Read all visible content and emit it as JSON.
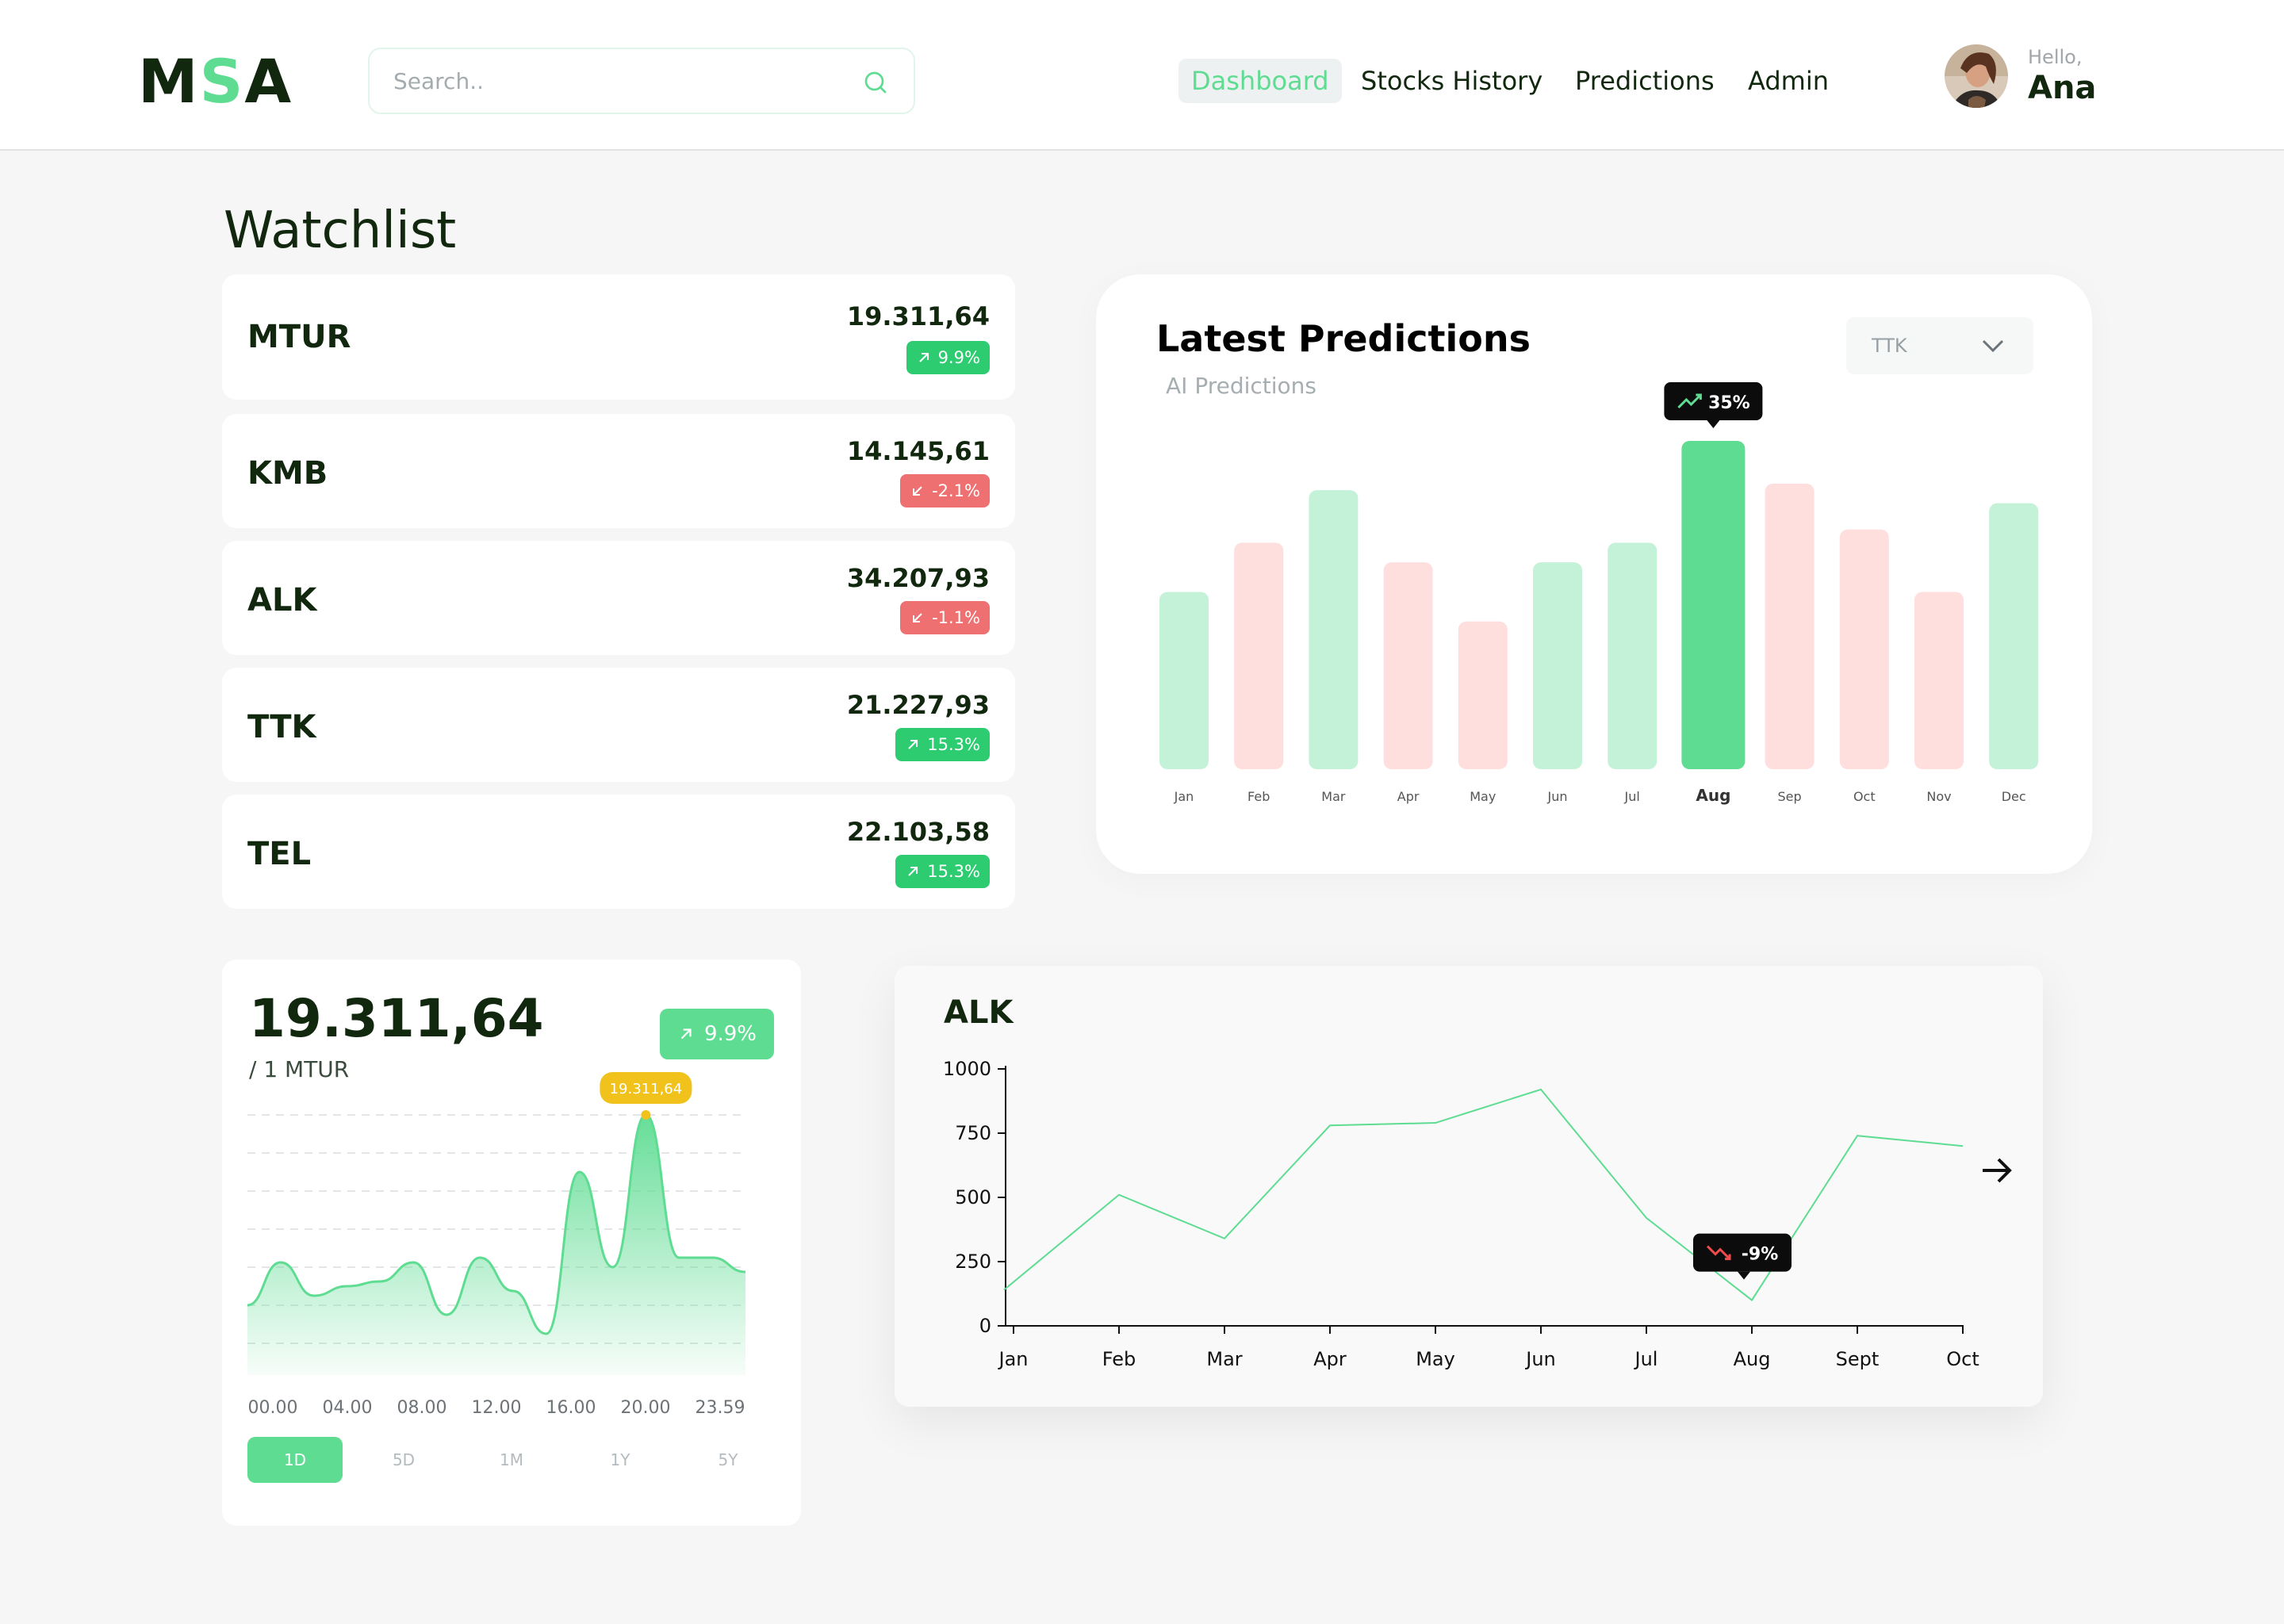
{
  "header": {
    "logo_prefix": "M",
    "logo_accent": "S",
    "logo_suffix": "A",
    "search_placeholder": "Search..",
    "nav": [
      {
        "label": "Dashboard",
        "active": true
      },
      {
        "label": "Stocks History",
        "active": false
      },
      {
        "label": "Predictions",
        "active": false
      },
      {
        "label": "Admin",
        "active": false
      }
    ],
    "user": {
      "greeting": "Hello,",
      "name": "Ana"
    }
  },
  "watchlist": {
    "title": "Watchlist",
    "items": [
      {
        "symbol": "MTUR",
        "price": "19.311,64",
        "change": "9.9%",
        "direction": "up"
      },
      {
        "symbol": "KMB",
        "price": "14.145,61",
        "change": "-2.1%",
        "direction": "down"
      },
      {
        "symbol": "ALK",
        "price": "34.207,93",
        "change": "-1.1%",
        "direction": "down"
      },
      {
        "symbol": "TTK",
        "price": "21.227,93",
        "change": "15.3%",
        "direction": "up"
      },
      {
        "symbol": "TEL",
        "price": "22.103,58",
        "change": "15.3%",
        "direction": "up"
      }
    ]
  },
  "predictions": {
    "title": "Latest Predictions",
    "subtitle": "AI Predictions",
    "selected_ticker": "TTK",
    "tooltip": "35%",
    "highlight_month": "Aug"
  },
  "intraday": {
    "price": "19.311,64",
    "unit": "/ 1 MTUR",
    "change": "9.9%",
    "peak_label": "19.311,64",
    "ranges": [
      {
        "label": "1D",
        "active": true
      },
      {
        "label": "5D",
        "active": false
      },
      {
        "label": "1M",
        "active": false
      },
      {
        "label": "1Y",
        "active": false
      },
      {
        "label": "5Y",
        "active": false
      }
    ]
  },
  "alk_chart": {
    "title": "ALK",
    "tooltip": "-9%"
  },
  "colors": {
    "accent": "#5edc92",
    "positive": "#2ecc71",
    "negative": "#ef7070",
    "pale_green": "#c4f2d9",
    "pale_red": "#ffdede",
    "text_dark": "#11280f"
  },
  "chart_data": [
    {
      "id": "predictions",
      "type": "bar",
      "categories": [
        "Jan",
        "Feb",
        "Mar",
        "Apr",
        "May",
        "Jun",
        "Jul",
        "Aug",
        "Sep",
        "Oct",
        "Nov",
        "Dec"
      ],
      "values": [
        54,
        69,
        85,
        63,
        45,
        63,
        69,
        100,
        87,
        73,
        54,
        81
      ],
      "direction": [
        "up",
        "down",
        "up",
        "down",
        "down",
        "up",
        "up",
        "up",
        "down",
        "down",
        "down",
        "up"
      ],
      "highlight": "Aug",
      "grid": false
    },
    {
      "id": "intraday",
      "type": "area",
      "x": [
        "00.00",
        "04.00",
        "08.00",
        "12.00",
        "16.00",
        "20.00",
        "23.59"
      ],
      "y": [
        40,
        85,
        50,
        60,
        65,
        85,
        30,
        90,
        55,
        10,
        180,
        80,
        240,
        90,
        90,
        75
      ],
      "peak_label": "19.311,64",
      "grid": true
    },
    {
      "id": "alk",
      "type": "line",
      "categories": [
        "Jan",
        "Feb",
        "Mar",
        "Apr",
        "May",
        "Jun",
        "Jul",
        "Aug",
        "Sept",
        "Oct"
      ],
      "values": [
        140,
        510,
        340,
        780,
        790,
        920,
        420,
        100,
        740,
        700
      ],
      "yticks": [
        0,
        250,
        500,
        750,
        1000
      ],
      "ylim": [
        0,
        1000
      ],
      "annotation": {
        "month": "Aug",
        "label": "-9%"
      },
      "grid": false
    }
  ]
}
